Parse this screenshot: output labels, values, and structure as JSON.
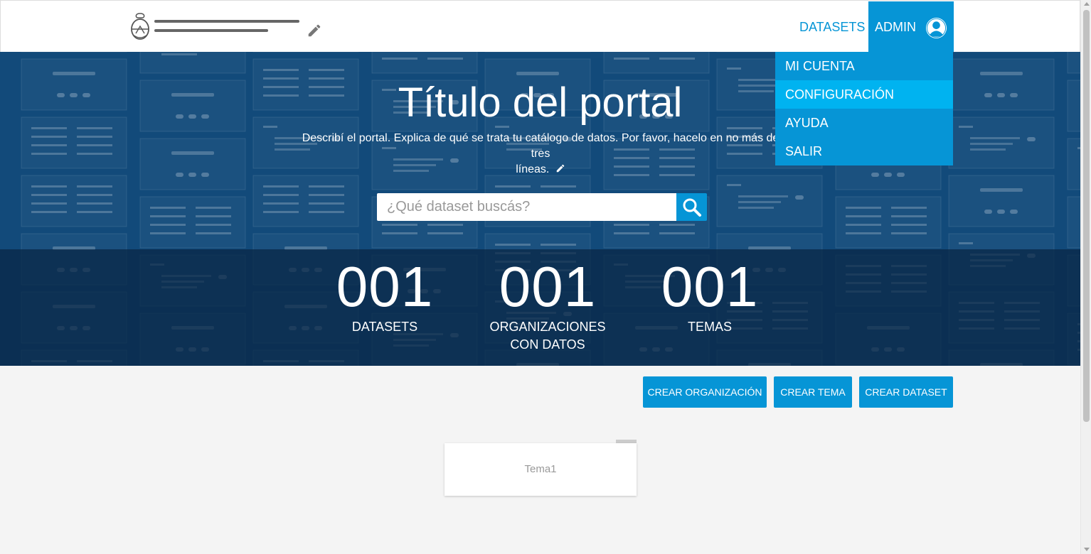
{
  "nav": {
    "datasets_label": "DATASETS",
    "admin_label": "ADMIN"
  },
  "dropdown": {
    "items": [
      "MI CUENTA",
      "CONFIGURACIÓN",
      "AYUDA",
      "SALIR"
    ],
    "active_item": "CONFIGURACIÓN"
  },
  "hero": {
    "title": "Título del portal",
    "description_line1": "Describí el portal. Explica de qué se trata tu catálogo de datos. Por favor, hacelo en no más de tres",
    "description_line2": "líneas.",
    "search_placeholder": "¿Qué dataset buscás?"
  },
  "stats": [
    {
      "number": "001",
      "label_line1": "DATASETS",
      "label_line2": ""
    },
    {
      "number": "001",
      "label_line1": "ORGANIZACIONES",
      "label_line2": "CON DATOS"
    },
    {
      "number": "001",
      "label_line1": "TEMAS",
      "label_line2": ""
    }
  ],
  "actions": {
    "create_org": "CREAR ORGANIZACIÓN",
    "create_theme": "CREAR TEMA",
    "create_dataset": "CREAR DATASET"
  },
  "themes": [
    "Tema1"
  ],
  "colors": {
    "primary": "#0695d6",
    "primary_light": "#00b3f0",
    "hero_bg": "#124a7a",
    "page_bg": "#f4f4f4"
  },
  "icons": {
    "logo": "argentina-coat-of-arms-icon",
    "edit": "pencil-icon",
    "avatar": "user-avatar-icon",
    "search": "search-icon"
  }
}
